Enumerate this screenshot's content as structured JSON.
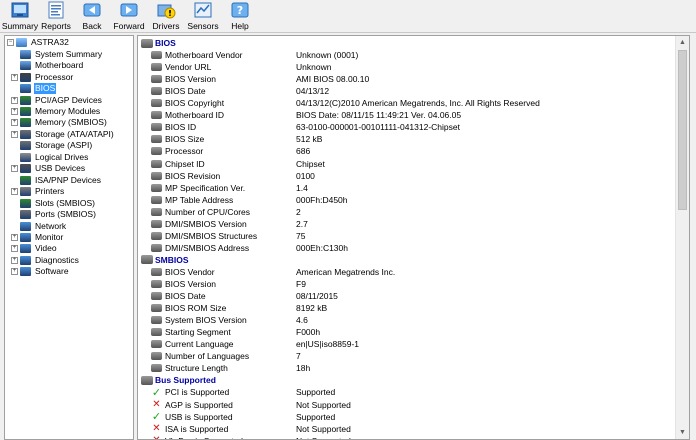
{
  "toolbar": {
    "buttons": [
      {
        "label": "Summary",
        "icon": "summary-icon"
      },
      {
        "label": "Reports",
        "icon": "reports-icon"
      },
      {
        "label": "Back",
        "icon": "back-arrow-icon"
      },
      {
        "label": "Forward",
        "icon": "forward-arrow-icon"
      },
      {
        "label": "Drivers",
        "icon": "drivers-icon"
      },
      {
        "label": "Sensors",
        "icon": "sensors-icon"
      },
      {
        "label": "Help",
        "icon": "help-icon"
      }
    ]
  },
  "tree": {
    "root": "ASTRA32",
    "items": [
      {
        "label": "System Summary",
        "expandable": false,
        "selected": false
      },
      {
        "label": "Motherboard",
        "expandable": false,
        "selected": false
      },
      {
        "label": "Processor",
        "expandable": true,
        "selected": false
      },
      {
        "label": "BIOS",
        "expandable": false,
        "selected": true
      },
      {
        "label": "PCI/AGP Devices",
        "expandable": true,
        "selected": false
      },
      {
        "label": "Memory Modules",
        "expandable": true,
        "selected": false
      },
      {
        "label": "Memory (SMBIOS)",
        "expandable": true,
        "selected": false
      },
      {
        "label": "Storage (ATA/ATAPI)",
        "expandable": true,
        "selected": false
      },
      {
        "label": "Storage (ASPI)",
        "expandable": false,
        "selected": false
      },
      {
        "label": "Logical Drives",
        "expandable": false,
        "selected": false
      },
      {
        "label": "USB Devices",
        "expandable": true,
        "selected": false
      },
      {
        "label": "ISA/PNP Devices",
        "expandable": false,
        "selected": false
      },
      {
        "label": "Printers",
        "expandable": true,
        "selected": false
      },
      {
        "label": "Slots (SMBIOS)",
        "expandable": false,
        "selected": false
      },
      {
        "label": "Ports (SMBIOS)",
        "expandable": false,
        "selected": false
      },
      {
        "label": "Network",
        "expandable": false,
        "selected": false
      },
      {
        "label": "Monitor",
        "expandable": true,
        "selected": false
      },
      {
        "label": "Video",
        "expandable": true,
        "selected": false
      },
      {
        "label": "Diagnostics",
        "expandable": true,
        "selected": false
      },
      {
        "label": "Software",
        "expandable": true,
        "selected": false
      }
    ]
  },
  "sections": [
    {
      "title": "BIOS",
      "fields": [
        {
          "name": "Motherboard Vendor",
          "value": "Unknown (0001)"
        },
        {
          "name": "Vendor URL",
          "value": "Unknown"
        },
        {
          "name": "BIOS Version",
          "value": "AMI BIOS 08.00.10"
        },
        {
          "name": "BIOS Date",
          "value": "04/13/12"
        },
        {
          "name": "BIOS Copyright",
          "value": "04/13/12(C)2010 American Megatrends, Inc. All Rights Reserved"
        },
        {
          "name": "Motherboard ID",
          "value": "BIOS Date: 08/11/15 11:49:21 Ver. 04.06.05"
        },
        {
          "name": "BIOS ID",
          "value": "63-0100-000001-00101111-041312-Chipset"
        },
        {
          "name": "BIOS Size",
          "value": "512 kB"
        },
        {
          "name": "Processor",
          "value": "686"
        },
        {
          "name": "Chipset ID",
          "value": "Chipset"
        },
        {
          "name": "BIOS Revision",
          "value": "0100"
        },
        {
          "name": "MP Specification Ver.",
          "value": "1.4"
        },
        {
          "name": "MP Table Address",
          "value": "000Fh:D450h"
        },
        {
          "name": "Number of CPU/Cores",
          "value": "2"
        },
        {
          "name": "DMI/SMBIOS Version",
          "value": "2.7"
        },
        {
          "name": "DMI/SMBIOS Structures",
          "value": "75"
        },
        {
          "name": "DMI/SMBIOS Address",
          "value": "000Eh:C130h"
        }
      ]
    },
    {
      "title": "SMBIOS",
      "fields": [
        {
          "name": "BIOS Vendor",
          "value": "American Megatrends Inc."
        },
        {
          "name": "BIOS Version",
          "value": "F9"
        },
        {
          "name": "BIOS Date",
          "value": "08/11/2015"
        },
        {
          "name": "BIOS ROM Size",
          "value": "8192 kB"
        },
        {
          "name": "System BIOS Version",
          "value": "4.6"
        },
        {
          "name": "Starting Segment",
          "value": "F000h"
        },
        {
          "name": "Current Language",
          "value": "en|US|iso8859-1"
        },
        {
          "name": "Number of Languages",
          "value": "7"
        },
        {
          "name": "Structure Length",
          "value": "18h"
        }
      ]
    },
    {
      "title": "Bus Supported",
      "fields": [
        {
          "name": "PCI is Supported",
          "value": "Supported",
          "status": "ok"
        },
        {
          "name": "AGP is Supported",
          "value": "Not Supported",
          "status": "no"
        },
        {
          "name": "USB is Supported",
          "value": "Supported",
          "status": "ok"
        },
        {
          "name": "ISA is Supported",
          "value": "Not Supported",
          "status": "no"
        },
        {
          "name": "VL-Bus is Supported",
          "value": "Not Supported",
          "status": "no"
        }
      ]
    }
  ],
  "colors": {
    "section_title": "#0000a0",
    "selection": "#3399ff",
    "ok": "#18a818",
    "no": "#d01818"
  }
}
